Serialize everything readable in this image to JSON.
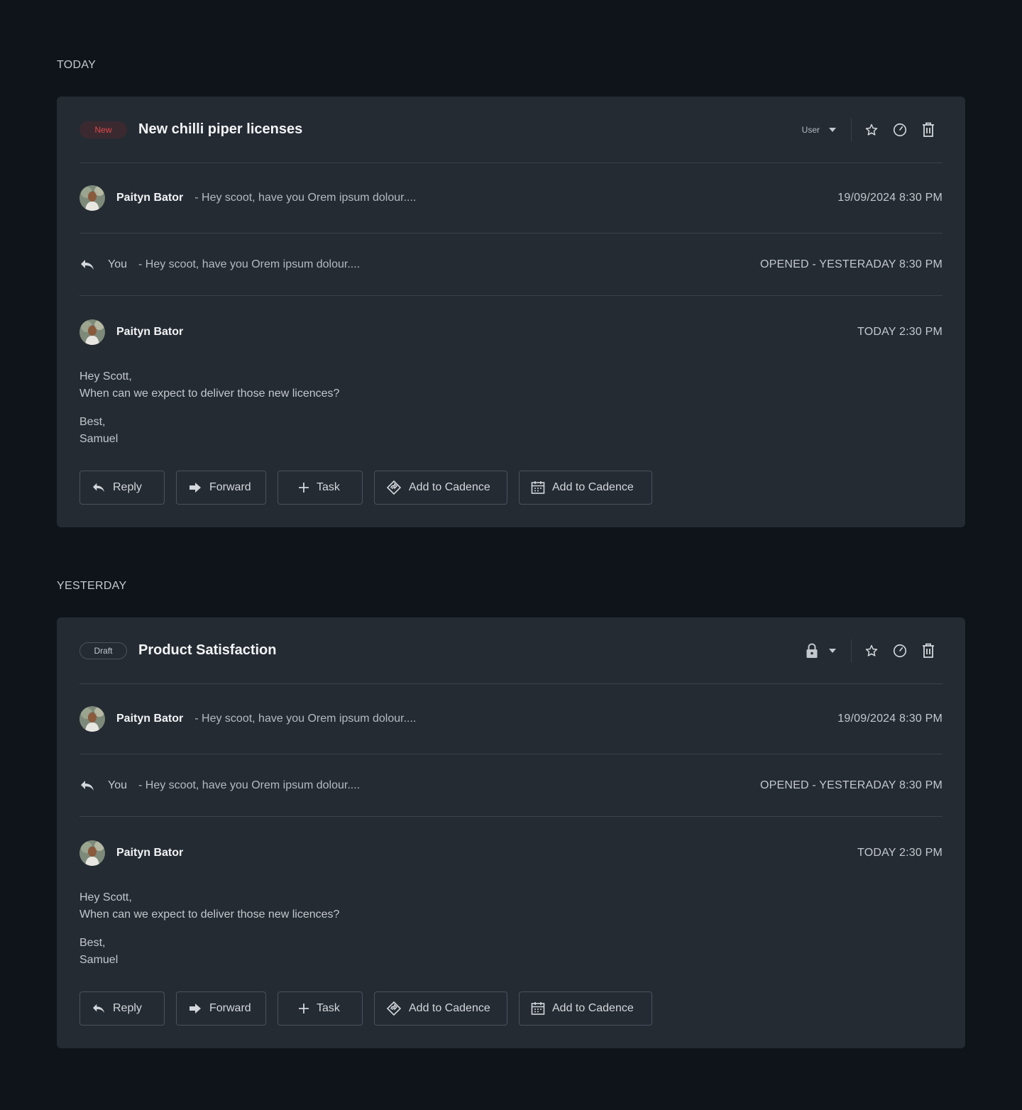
{
  "threads": [
    {
      "section_label": "TODAY",
      "badge": "New",
      "subject": "New chilli piper licenses",
      "owner_label": "User",
      "first_message": {
        "sender": "Paityn Bator",
        "snippet": "- Hey scoot, have you Orem ipsum dolour....",
        "timestamp": "19/09/2024 8:30 PM"
      },
      "reply_message": {
        "sender": "You",
        "snippet": "- Hey scoot, have you Orem ipsum dolour....",
        "status": "OPENED - YESTERADAY 8:30 PM"
      },
      "open_message": {
        "sender": "Paityn Bator",
        "timestamp": "TODAY 2:30 PM",
        "greeting": "Hey Scott,",
        "line": "When can we expect to deliver those new licences?",
        "signoff": "Best,",
        "signature": "Samuel"
      },
      "actions": {
        "reply": "Reply",
        "forward": "Forward",
        "task": "Task",
        "cadence": "Add to Cadence",
        "schedule": "Add to Cadence"
      }
    },
    {
      "section_label": "YESTERDAY",
      "badge": "Draft",
      "subject": "Product Satisfaction",
      "owner_icon": "lock-icon",
      "first_message": {
        "sender": "Paityn Bator",
        "snippet": "- Hey scoot, have you Orem ipsum dolour....",
        "timestamp": "19/09/2024 8:30 PM"
      },
      "reply_message": {
        "sender": "You",
        "snippet": "- Hey scoot, have you Orem ipsum dolour....",
        "status": "OPENED - YESTERADAY 8:30 PM"
      },
      "open_message": {
        "sender": "Paityn Bator",
        "timestamp": "TODAY 2:30 PM",
        "greeting": "Hey Scott,",
        "line": "When can we expect to deliver those new licences?",
        "signoff": "Best,",
        "signature": "Samuel"
      },
      "actions": {
        "reply": "Reply",
        "forward": "Forward",
        "task": "Task",
        "cadence": "Add to Cadence",
        "schedule": "Add to Cadence"
      }
    }
  ],
  "colors": {
    "page_bg": "#0f141b",
    "card_bg": "#252b33",
    "new_badge": "#e0474c"
  },
  "icons": [
    "star-icon",
    "clock-icon",
    "trash-icon",
    "chevron-down-icon",
    "reply-icon",
    "forward-icon",
    "plus-icon",
    "cadence-icon",
    "calendar-icon",
    "lock-icon"
  ]
}
